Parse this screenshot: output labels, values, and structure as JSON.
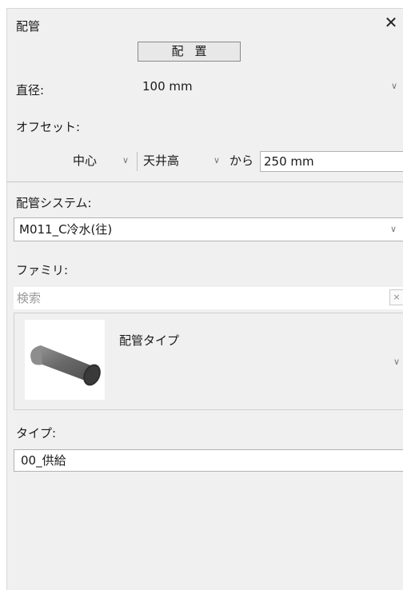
{
  "panel": {
    "title": "配管",
    "close_symbol": "✕",
    "place_button": "配置"
  },
  "diameter": {
    "label": "直径:",
    "value": "100 mm"
  },
  "offset": {
    "label": "オフセット:",
    "reference": "中心",
    "level": "天井高",
    "from_label": "から",
    "value": "250 mm"
  },
  "system": {
    "label": "配管システム:",
    "value": "M011_C冷水(往)"
  },
  "family": {
    "label": "ファミリ:",
    "search_placeholder": "検索",
    "search_clear": "×",
    "item_name": "配管タイプ",
    "thumbnail_icon": "pipe-cylinder-icon"
  },
  "type": {
    "label": "タイプ:",
    "value": "00_供給"
  },
  "icons": {
    "chevron": "chevron-down-icon",
    "close": "close-icon"
  },
  "colors": {
    "panel_bg": "#f0f0f0",
    "field_bg": "#ffffff",
    "border": "#b3b3b3",
    "placeholder": "#9a9a9a"
  }
}
